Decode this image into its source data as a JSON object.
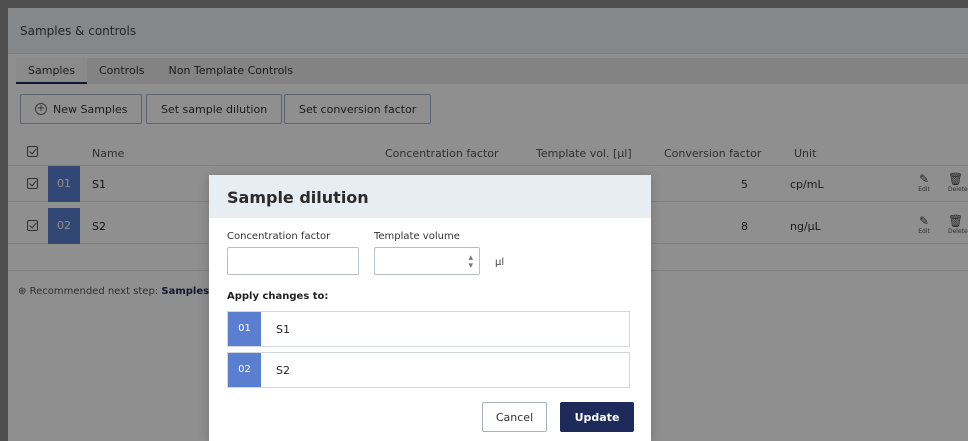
{
  "section": {
    "title": "Samples & controls"
  },
  "tabs": [
    {
      "label": "Samples",
      "active": true
    },
    {
      "label": "Controls",
      "active": false
    },
    {
      "label": "Non Template Controls",
      "active": false
    }
  ],
  "toolbar": {
    "new_samples": "New Samples",
    "set_dilution": "Set sample dilution",
    "set_conversion": "Set conversion factor"
  },
  "table": {
    "headers": {
      "name": "Name",
      "concentration": "Concentration factor",
      "template_vol": "Template vol. [µl]",
      "conversion": "Conversion factor",
      "unit": "Unit"
    },
    "rows": [
      {
        "num": "01",
        "name": "S1",
        "conversion": "5",
        "unit": "cp/mL",
        "edit": "Edit",
        "delete": "Delete"
      },
      {
        "num": "02",
        "name": "S2",
        "conversion": "8",
        "unit": "ng/µL",
        "edit": "Edit",
        "delete": "Delete"
      }
    ]
  },
  "next_step": {
    "prefix": "Recommended next step:",
    "link": "Samples &"
  },
  "modal": {
    "title": "Sample dilution",
    "concentration_label": "Concentration factor",
    "concentration_value": "",
    "template_label": "Template volume",
    "template_value": "",
    "template_unit": "µl",
    "apply_label": "Apply changes to:",
    "items": [
      {
        "num": "01",
        "name": "S1"
      },
      {
        "num": "02",
        "name": "S2"
      }
    ],
    "cancel": "Cancel",
    "update": "Update"
  },
  "colors": {
    "accent": "#1d2a5a",
    "sample_badge": "#5b7fd0",
    "overlay": "#8e8e8e"
  }
}
